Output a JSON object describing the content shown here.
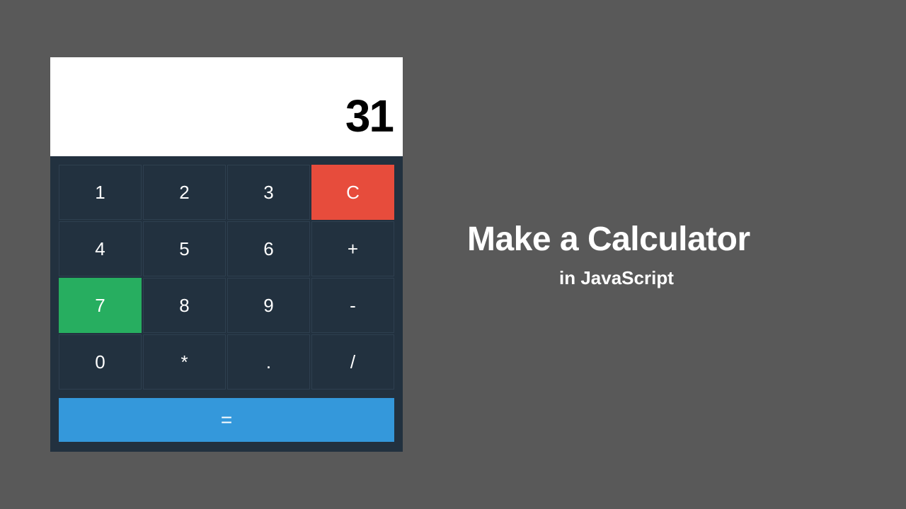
{
  "heading": {
    "title": "Make a Calculator",
    "subtitle": "in JavaScript"
  },
  "calculator": {
    "display": "31",
    "keys": {
      "r0c0": "1",
      "r0c1": "2",
      "r0c2": "3",
      "r0c3": "C",
      "r1c0": "4",
      "r1c1": "5",
      "r1c2": "6",
      "r1c3": "+",
      "r2c0": "7",
      "r2c1": "8",
      "r2c2": "9",
      "r2c3": "-",
      "r3c0": "0",
      "r3c1": "*",
      "r3c2": ".",
      "r3c3": "/",
      "equals": "="
    },
    "colors": {
      "background": "#595959",
      "panel": "#22313f",
      "display_bg": "#ffffff",
      "clear_bg": "#e74c3c",
      "active_bg": "#27ae60",
      "equals_bg": "#3498db"
    }
  }
}
